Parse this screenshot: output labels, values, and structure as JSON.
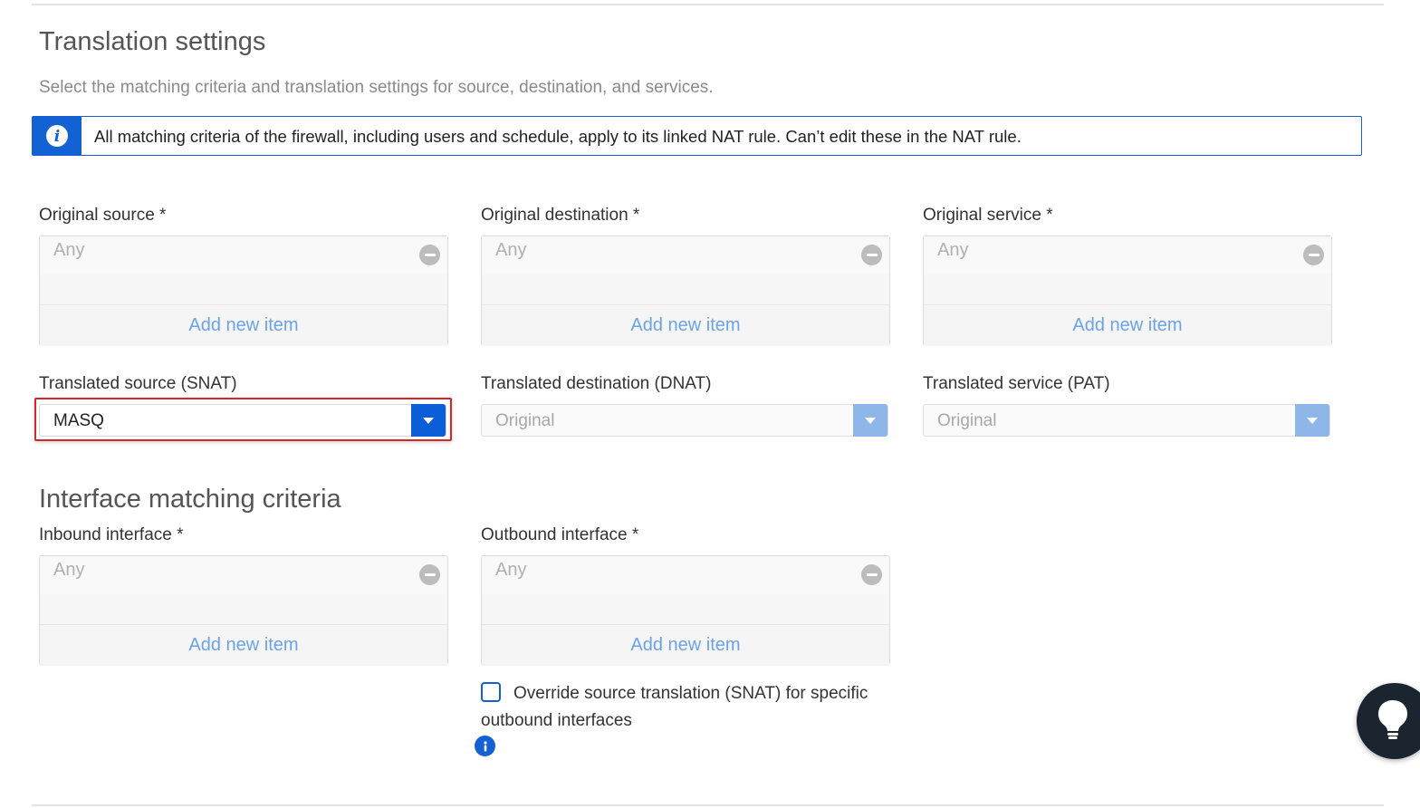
{
  "translation_settings": {
    "title": "Translation settings",
    "subtitle": "Select the matching criteria and translation settings for source, destination, and services.",
    "info_banner": "All matching criteria of the firewall, including users and schedule, apply to its linked NAT rule. Can’t edit these in the NAT rule.",
    "original_source": {
      "label": "Original source *",
      "item": "Any",
      "add_label": "Add new item"
    },
    "original_destination": {
      "label": "Original destination *",
      "item": "Any",
      "add_label": "Add new item"
    },
    "original_service": {
      "label": "Original service *",
      "item": "Any",
      "add_label": "Add new item"
    },
    "translated_source": {
      "label": "Translated source (SNAT)",
      "value": "MASQ"
    },
    "translated_destination": {
      "label": "Translated destination (DNAT)",
      "value": "Original"
    },
    "translated_service": {
      "label": "Translated service (PAT)",
      "value": "Original"
    }
  },
  "interface_matching": {
    "title": "Interface matching criteria",
    "inbound": {
      "label": "Inbound interface *",
      "item": "Any",
      "add_label": "Add new item"
    },
    "outbound": {
      "label": "Outbound interface *",
      "item": "Any",
      "add_label": "Add new item"
    },
    "override_checkbox": {
      "label": "Override source translation (SNAT) for specific outbound interfaces",
      "checked": false
    }
  },
  "colors": {
    "accent": "#1262d3",
    "highlight": "#d6262b",
    "link": "#6aa3e8"
  },
  "icons": {
    "info": "info-icon",
    "remove": "minus-circle-icon",
    "dropdown": "chevron-down-icon",
    "help": "lightbulb-icon"
  }
}
